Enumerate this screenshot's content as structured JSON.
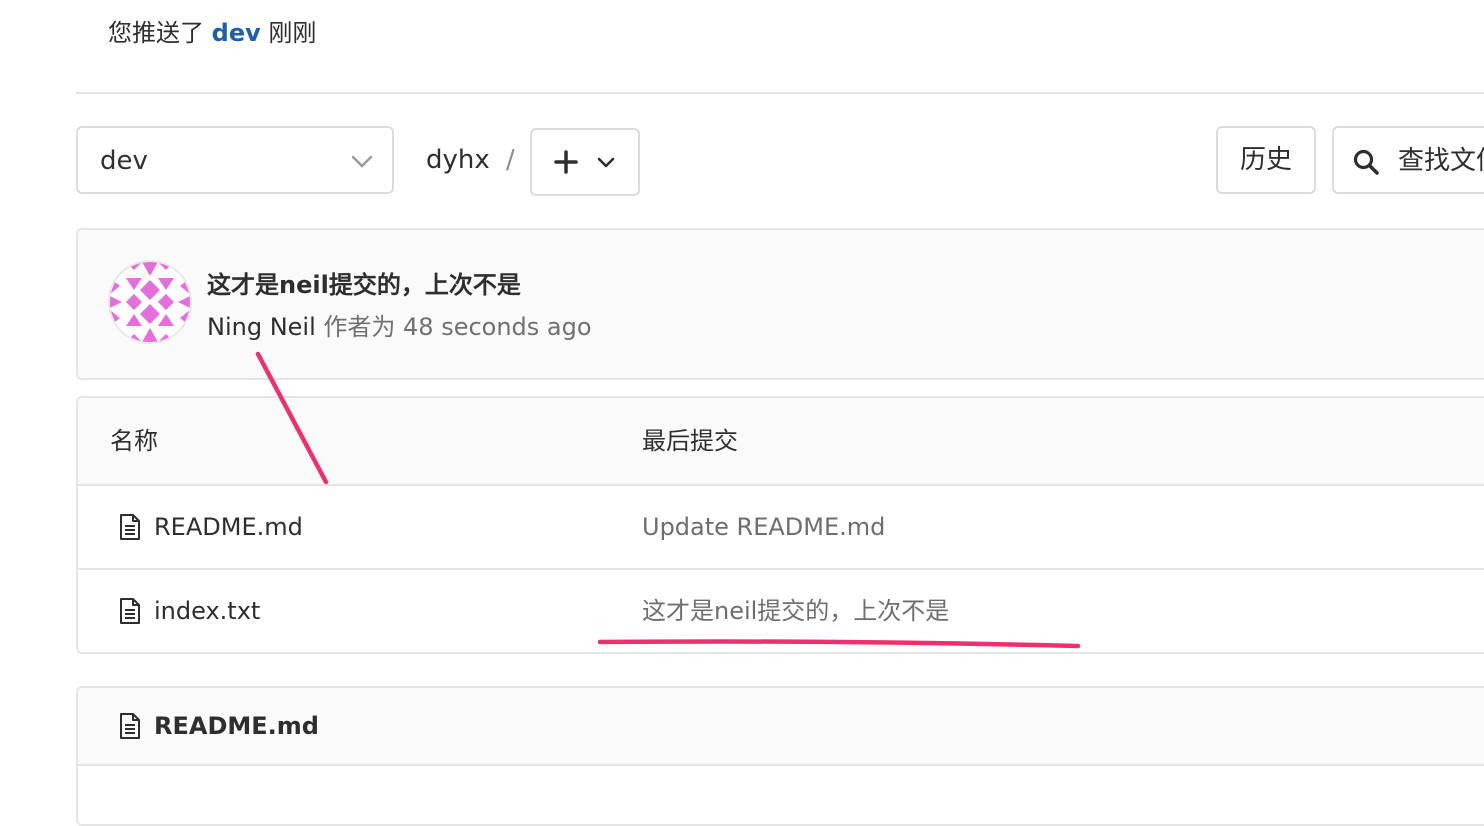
{
  "push_banner": {
    "prefix": "您推送了",
    "branch": "dev",
    "suffix": "刚刚"
  },
  "toolbar": {
    "branch_value": "dev",
    "repo_crumb": "dyhx",
    "crumb_separator": "/",
    "history_label": "历史",
    "find_file_label": "查找文件"
  },
  "last_commit": {
    "title": "这才是neil提交的，上次不是",
    "author": "Ning Neil",
    "authored_label": "作者为",
    "time": "48 seconds ago"
  },
  "file_table": {
    "headers": {
      "name": "名称",
      "last_commit": "最后提交"
    },
    "rows": [
      {
        "name": "README.md",
        "commit": "Update README.md"
      },
      {
        "name": "index.txt",
        "commit": "这才是neil提交的，上次不是"
      }
    ]
  },
  "readme": {
    "title": "README.md"
  },
  "colors": {
    "branch_link": "#1f5fa6",
    "annotation": "#f0306e",
    "avatar": "#e26fdc"
  },
  "icons": [
    "chevron-down-icon",
    "plus-icon",
    "search-icon",
    "file-icon",
    "identicon-avatar"
  ]
}
